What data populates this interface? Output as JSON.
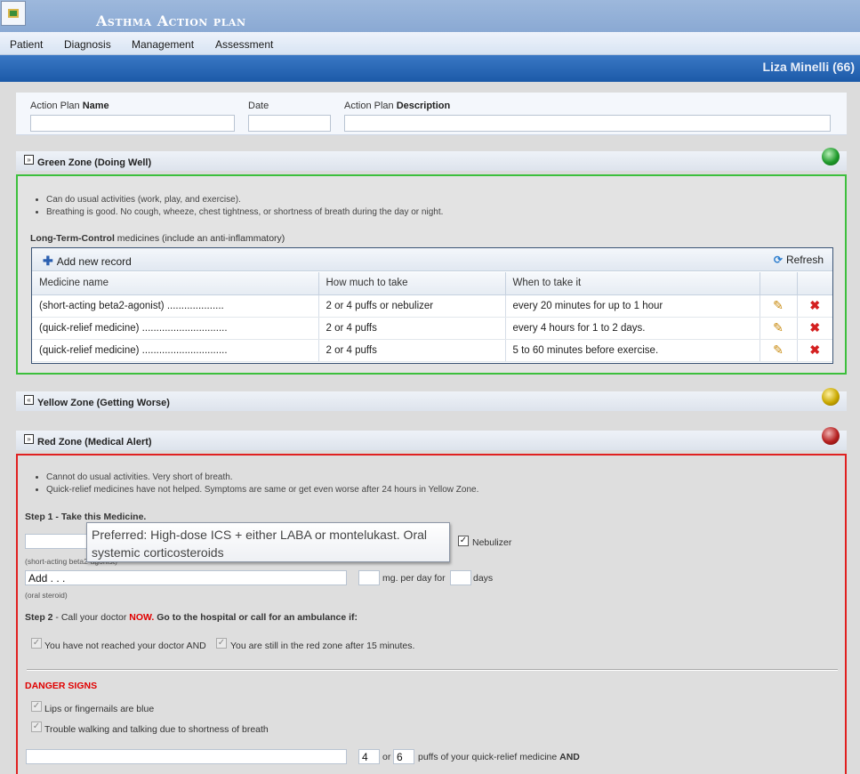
{
  "app": {
    "title": "Asthma Action plan",
    "patient": "Liza Minelli (66)"
  },
  "menu": [
    "Patient",
    "Diagnosis",
    "Management",
    "Assessment"
  ],
  "header": {
    "name_label_prefix": "Action Plan ",
    "name_label_bold": "Name",
    "name_value": "",
    "date_label": "Date",
    "date_value": "",
    "desc_label_prefix": "Action Plan ",
    "desc_label_bold": "Description",
    "desc_value": ""
  },
  "green_zone": {
    "title": "Green Zone (Doing Well)",
    "collapse_glyph": "»",
    "light_color": "#1f9a2b",
    "bullets": [
      "Can do usual activities (work, play, and exercise).",
      "Breathing is good. No cough, wheeze, chest tightness, or shortness of breath during the day or night."
    ],
    "ltc_bold": "Long-Term-Control",
    "ltc_rest": " medicines (include an anti-inflammatory)",
    "grid": {
      "add_label": "Add new record",
      "refresh_label": "Refresh",
      "columns": [
        "Medicine name",
        "How much to take",
        "When to take it"
      ],
      "rows": [
        {
          "medicine": "(short-acting beta2-agonist) ....................",
          "amount": "2 or 4 puffs or nebulizer",
          "when": "every 20 minutes for up to 1 hour"
        },
        {
          "medicine": "(quick-relief medicine) ..............................",
          "amount": "2 or 4 puffs",
          "when": "every 4 hours for 1 to 2 days."
        },
        {
          "medicine": "(quick-relief medicine) ..............................",
          "amount": "2 or 4 puffs",
          "when": "5 to 60 minutes before exercise."
        }
      ]
    }
  },
  "yellow_zone": {
    "title": "Yellow Zone (Getting Worse)",
    "collapse_glyph": "«",
    "light_color": "#c9a800"
  },
  "red_zone": {
    "title": "Red Zone (Medical Alert)",
    "collapse_glyph": "»",
    "light_color": "#b52020",
    "bullets": [
      "Cannot do usual activities. Very short of breath.",
      "Quick-relief medicines have not helped. Symptoms are same or get even worse after 24 hours in Yellow Zone."
    ],
    "step1_bold": "Step 1 - Take this Medicine.",
    "beta_caption": "(short-acting beta2-agonist)",
    "nebulizer_label": "Nebulizer",
    "nebulizer_checked": true,
    "steroid_value": "Add . . .",
    "mg_label": "mg. per day for",
    "days_label": "days",
    "steroid_caption": "(oral steroid)",
    "step2_prefix": "Step 2",
    "step2_mid": " - Call your doctor ",
    "step2_now": "NOW.",
    "step2_rest": " Go to the hospital or call for an ambulance if:",
    "cb_not_reached": "You have not reached your doctor AND",
    "cb_still_red": "You are still in the red zone after 15 minutes.",
    "danger_title": "DANGER SIGNS",
    "danger_1": "Lips or fingernails are blue",
    "danger_2": "Trouble walking and talking due to shortness of breath",
    "puffs_a": "4",
    "puffs_or": "or",
    "puffs_b": "6",
    "puffs_label": "puffs of your quick-relief medicine ",
    "puffs_and": "AND"
  },
  "tooltip": "Preferred: High-dose ICS + either LABA or montelukast. Oral systemic corticosteroids"
}
